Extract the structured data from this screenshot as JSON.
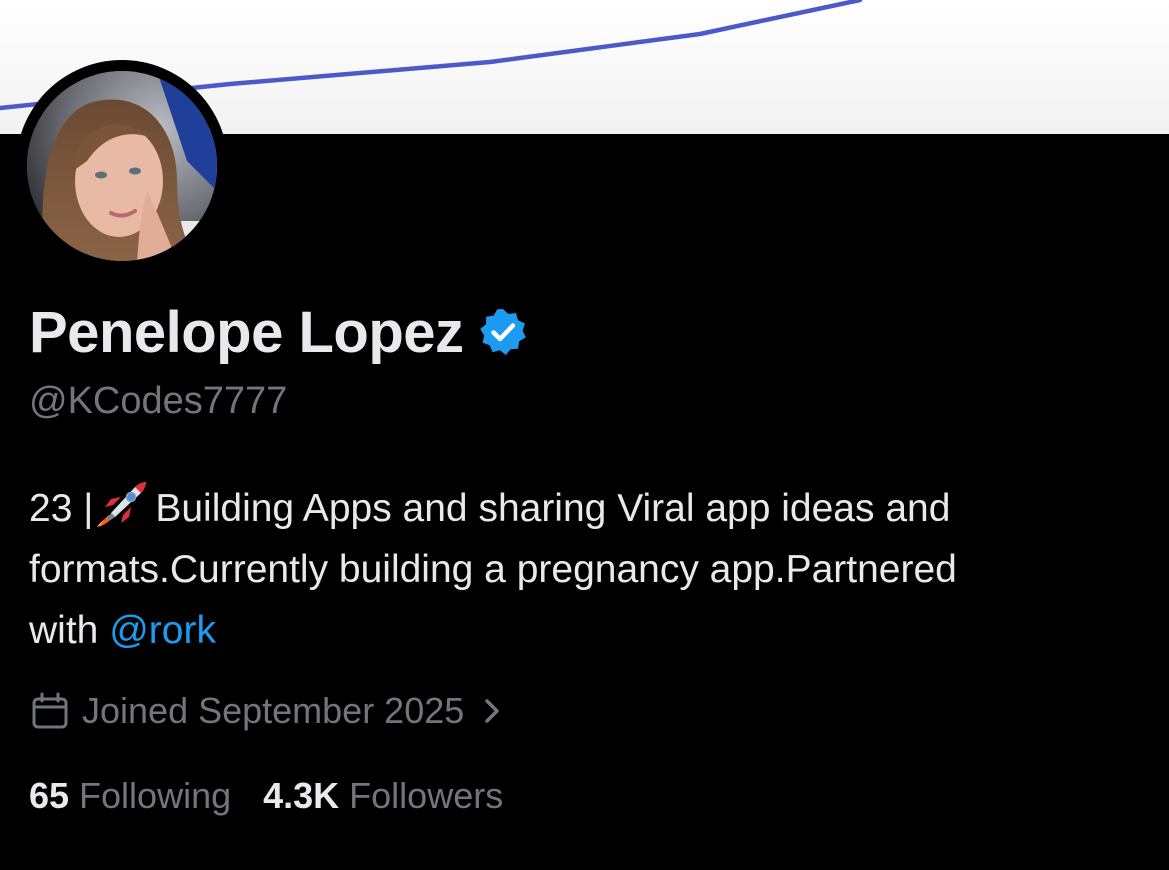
{
  "profile": {
    "display_name": "Penelope Lopez",
    "handle": "@KCodes7777",
    "verified_icon": "verified-badge-icon",
    "avatar_icon": "avatar-photo"
  },
  "bio": {
    "line1_prefix": "23 |",
    "line1_suffix": "Building Apps and sharing Viral app ideas and",
    "line2": "formats.Currently building a pregnancy app.Partnered",
    "line3_prefix": "with",
    "mention": "@rork",
    "emoji_icon": "rocket-icon"
  },
  "joined": {
    "text": "Joined September 2025",
    "icon": "calendar-icon",
    "chevron": "chevron-right-icon"
  },
  "stats": {
    "following_count": "65",
    "following_label": "Following",
    "followers_count": "4.3K",
    "followers_label": "Followers"
  },
  "colors": {
    "background": "#000000",
    "primary_text": "#e7e9ea",
    "secondary_text": "#71767b",
    "accent": "#1d9bf0",
    "banner_line": "#4b59c9"
  }
}
